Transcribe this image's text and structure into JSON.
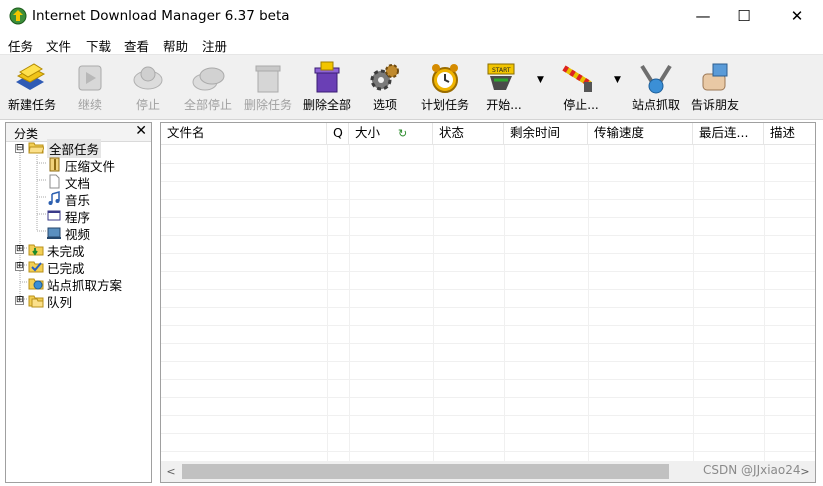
{
  "window": {
    "title": "Internet Download Manager 6.37 beta",
    "minimize_glyph": "—",
    "maximize_glyph": "☐",
    "close_glyph": "✕"
  },
  "menu": [
    "任务",
    "文件",
    "下载",
    "查看",
    "帮助",
    "注册"
  ],
  "toolbar": {
    "buttons": [
      {
        "label": "新建任务",
        "icon": "new-task-icon",
        "enabled": true
      },
      {
        "label": "继续",
        "icon": "resume-icon",
        "enabled": false
      },
      {
        "label": "停止",
        "icon": "stop-icon",
        "enabled": false
      },
      {
        "label": "全部停止",
        "icon": "stop-all-icon",
        "enabled": false
      },
      {
        "label": "删除任务",
        "icon": "delete-task-icon",
        "enabled": false
      },
      {
        "label": "删除全部",
        "icon": "delete-all-icon",
        "enabled": true
      },
      {
        "label": "选项",
        "icon": "options-gear-icon",
        "enabled": true
      },
      {
        "label": "计划任务",
        "icon": "scheduler-clock-icon",
        "enabled": true
      },
      {
        "label": "开始...",
        "icon": "start-queue-icon",
        "enabled": true,
        "dropdown": true
      },
      {
        "label": "停止...",
        "icon": "stop-queue-icon",
        "enabled": true,
        "dropdown": true
      },
      {
        "label": "站点抓取",
        "icon": "site-grabber-icon",
        "enabled": true
      },
      {
        "label": "告诉朋友",
        "icon": "tell-friend-icon",
        "enabled": true
      }
    ],
    "dropdown_glyph": "▼"
  },
  "sidebar": {
    "title": "分类",
    "close_glyph": "✕",
    "tree": [
      {
        "label": "全部任务",
        "icon": "folder-open-icon",
        "level": 0,
        "expander": "⊟",
        "selected": true
      },
      {
        "label": "压缩文件",
        "icon": "archive-icon",
        "level": 1
      },
      {
        "label": "文档",
        "icon": "document-icon",
        "level": 1
      },
      {
        "label": "音乐",
        "icon": "music-icon",
        "level": 1
      },
      {
        "label": "程序",
        "icon": "program-icon",
        "level": 1
      },
      {
        "label": "视频",
        "icon": "video-icon",
        "level": 1
      },
      {
        "label": "未完成",
        "icon": "unfinished-folder-icon",
        "level": 0,
        "expander": "⊞"
      },
      {
        "label": "已完成",
        "icon": "finished-folder-icon",
        "level": 0,
        "expander": "⊞"
      },
      {
        "label": "站点抓取方案",
        "icon": "grabber-projects-icon",
        "level": 0
      },
      {
        "label": "队列",
        "icon": "queues-folder-icon",
        "level": 0,
        "expander": "⊞"
      }
    ]
  },
  "list": {
    "columns": [
      "文件名",
      "Q",
      "大小",
      "状态",
      "剩余时间",
      "传输速度",
      "最后连...",
      "描述"
    ],
    "sort_indicator": "↻",
    "rows": []
  },
  "scrollbar": {
    "left_arrow": "<",
    "right_arrow": ">"
  },
  "watermark": "CSDN @JJxiao24"
}
